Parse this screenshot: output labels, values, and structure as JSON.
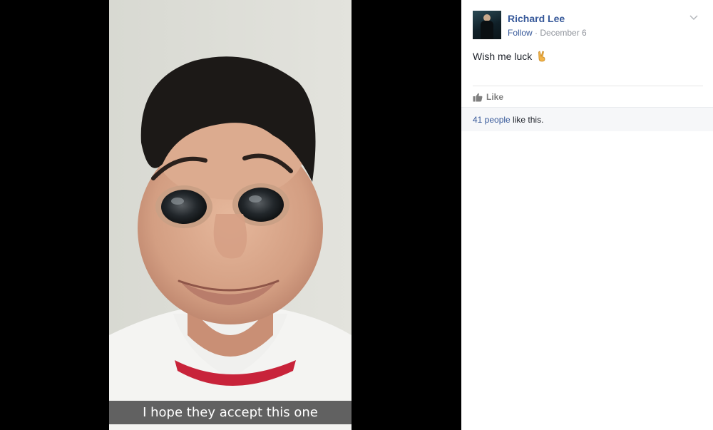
{
  "photo": {
    "caption": "I hope they accept this one"
  },
  "post": {
    "author": "Richard Lee",
    "follow_label": "Follow",
    "separator": " · ",
    "date": "December 6",
    "text": "Wish me luck",
    "emoji_icon": "victory-hand-icon",
    "like_label": "Like",
    "likes_count_text": "41 people",
    "likes_suffix": " like this."
  },
  "colors": {
    "link": "#365899",
    "meta": "#90949c",
    "text": "#1d2129"
  }
}
